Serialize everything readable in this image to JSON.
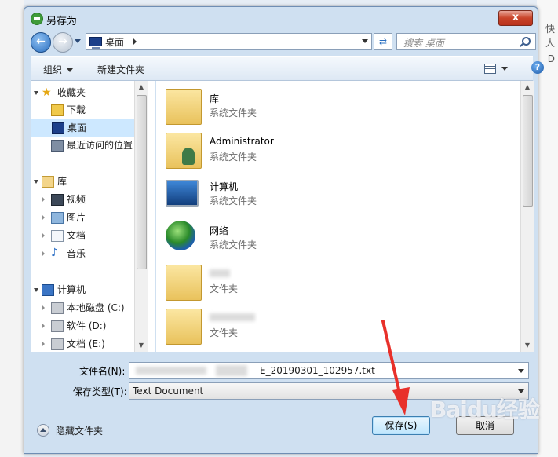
{
  "window": {
    "title": "另存为",
    "close_label": "x"
  },
  "background_right": [
    "快",
    "人",
    "D"
  ],
  "address": {
    "path": "桌面",
    "search_placeholder": "搜索 桌面"
  },
  "toolbar": {
    "organize_label": "组织",
    "new_folder_label": "新建文件夹",
    "help_label": "?"
  },
  "nav": {
    "favorites_label": "收藏夹",
    "downloads_label": "下载",
    "desktop_label": "桌面",
    "recent_label": "最近访问的位置",
    "libraries_label": "库",
    "videos_label": "视频",
    "pictures_label": "图片",
    "documents_label": "文档",
    "music_label": "音乐",
    "computer_label": "计算机",
    "local_disk_label": "本地磁盘 (C:)",
    "software_disk_label": "软件 (D:)",
    "docs_disk_label": "文档 (E:)"
  },
  "files": [
    {
      "name": "库",
      "type": "系统文件夹",
      "icon": "library-icon"
    },
    {
      "name": "Administrator",
      "type": "系统文件夹",
      "icon": "user-folder-icon"
    },
    {
      "name": "计算机",
      "type": "系统文件夹",
      "icon": "computer-icon"
    },
    {
      "name": "网络",
      "type": "系统文件夹",
      "icon": "network-icon"
    },
    {
      "name": "",
      "type": "文件夹",
      "icon": "folder-icon"
    },
    {
      "name": "",
      "type": "文件夹",
      "icon": "folder-icon"
    }
  ],
  "form": {
    "filename_label": "文件名(N):",
    "filename_value": "E_20190301_102957.txt",
    "filetype_label": "保存类型(T):",
    "filetype_value": "Text Document",
    "hide_folders_label": "隐藏文件夹",
    "save_label": "保存(S)",
    "cancel_label": "取消"
  },
  "watermark": "Baidu经验",
  "colors": {
    "accent": "#3c7fb1",
    "selection": "#cde8ff",
    "close": "#c9442a",
    "arrow": "#e8302a"
  }
}
